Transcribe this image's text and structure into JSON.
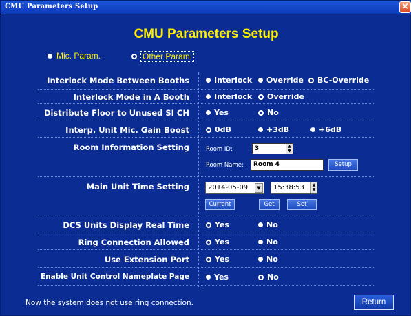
{
  "window": {
    "title": "CMU Parameters Setup",
    "close": "×"
  },
  "heading": "CMU Parameters Setup",
  "tabs": {
    "mic": "Mic. Param.",
    "other": "Other Param."
  },
  "rows": {
    "interlock_booths": {
      "label": "Interlock Mode Between Booths",
      "options": [
        "Interlock",
        "Override",
        "BC-Override"
      ]
    },
    "interlock_a_booth": {
      "label": "Interlock Mode in A Booth",
      "options": [
        "Interlock",
        "Override"
      ]
    },
    "distribute_floor": {
      "label": "Distribute Floor to Unused SI CH",
      "options": [
        "Yes",
        "No"
      ]
    },
    "gain_boost": {
      "label": "Interp. Unit Mic. Gain Boost",
      "options": [
        "0dB",
        "+3dB",
        "+6dB"
      ]
    },
    "room_info": {
      "label": "Room Information Setting",
      "room_id_label": "Room ID:",
      "room_id_value": "3",
      "room_name_label": "Room Name:",
      "room_name_value": "Room 4",
      "setup": "Setup"
    },
    "time_setting": {
      "label": "Main Unit Time Setting",
      "date": "2014-05-09",
      "time": "15:38:53",
      "current": "Current",
      "get": "Get",
      "set": "Set"
    },
    "dcs_display": {
      "label": "DCS Units Display Real Time",
      "options": [
        "Yes",
        "No"
      ]
    },
    "ring_connection": {
      "label": "Ring Connection Allowed",
      "options": [
        "Yes",
        "No"
      ]
    },
    "extension_port": {
      "label": "Use Extension Port",
      "options": [
        "Yes",
        "No"
      ]
    },
    "nameplate": {
      "label": "Enable Unit Control Nameplate Page",
      "options": [
        "Yes",
        "No"
      ]
    }
  },
  "status": "Now the system does not use ring connection.",
  "return_label": "Return",
  "colors": {
    "background": "#0b2d93",
    "accent": "#ffee00",
    "titlebar": "#1e56d8"
  }
}
